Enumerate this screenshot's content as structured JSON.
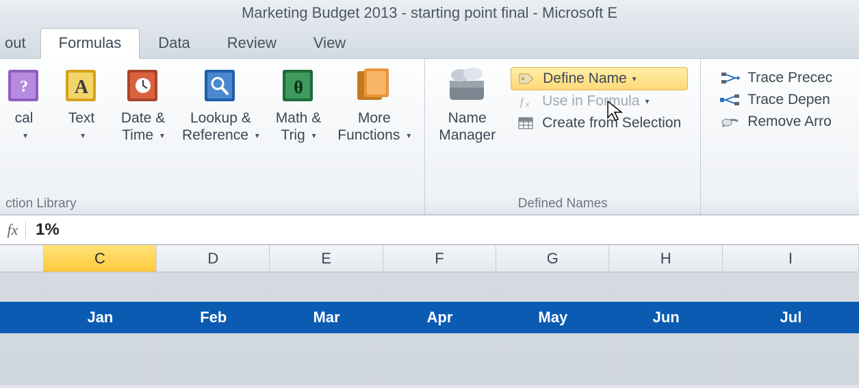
{
  "title": "Marketing Budget 2013 - starting point final  -  Microsoft E",
  "tabs": {
    "partial_first": "out",
    "formulas": "Formulas",
    "data": "Data",
    "review": "Review",
    "view": "View"
  },
  "ribbon": {
    "function_library": {
      "group_label": "ction Library",
      "logical": {
        "label_line1": "cal",
        "label_line2": ""
      },
      "text": {
        "label_line1": "Text",
        "label_line2": ""
      },
      "datetime": {
        "label_line1": "Date &",
        "label_line2": "Time"
      },
      "lookup": {
        "label_line1": "Lookup &",
        "label_line2": "Reference"
      },
      "mathtrig": {
        "label_line1": "Math &",
        "label_line2": "Trig"
      },
      "more": {
        "label_line1": "More",
        "label_line2": "Functions"
      }
    },
    "defined_names": {
      "group_label": "Defined Names",
      "name_manager": {
        "label_line1": "Name",
        "label_line2": "Manager"
      },
      "define_name": "Define Name",
      "use_in_formula": "Use in Formula",
      "create_from_selection": "Create from Selection"
    },
    "formula_auditing": {
      "trace_precedents": "Trace Precec",
      "trace_dependents": "Trace Depen",
      "remove_arrows": "Remove Arro"
    }
  },
  "formula_bar": {
    "fx_label": "fx",
    "value": "1%"
  },
  "columns": [
    "C",
    "D",
    "E",
    "F",
    "G",
    "H",
    "I"
  ],
  "months_row": [
    "Jan",
    "Feb",
    "Mar",
    "Apr",
    "May",
    "Jun",
    "Jul"
  ],
  "selected_column": "C"
}
